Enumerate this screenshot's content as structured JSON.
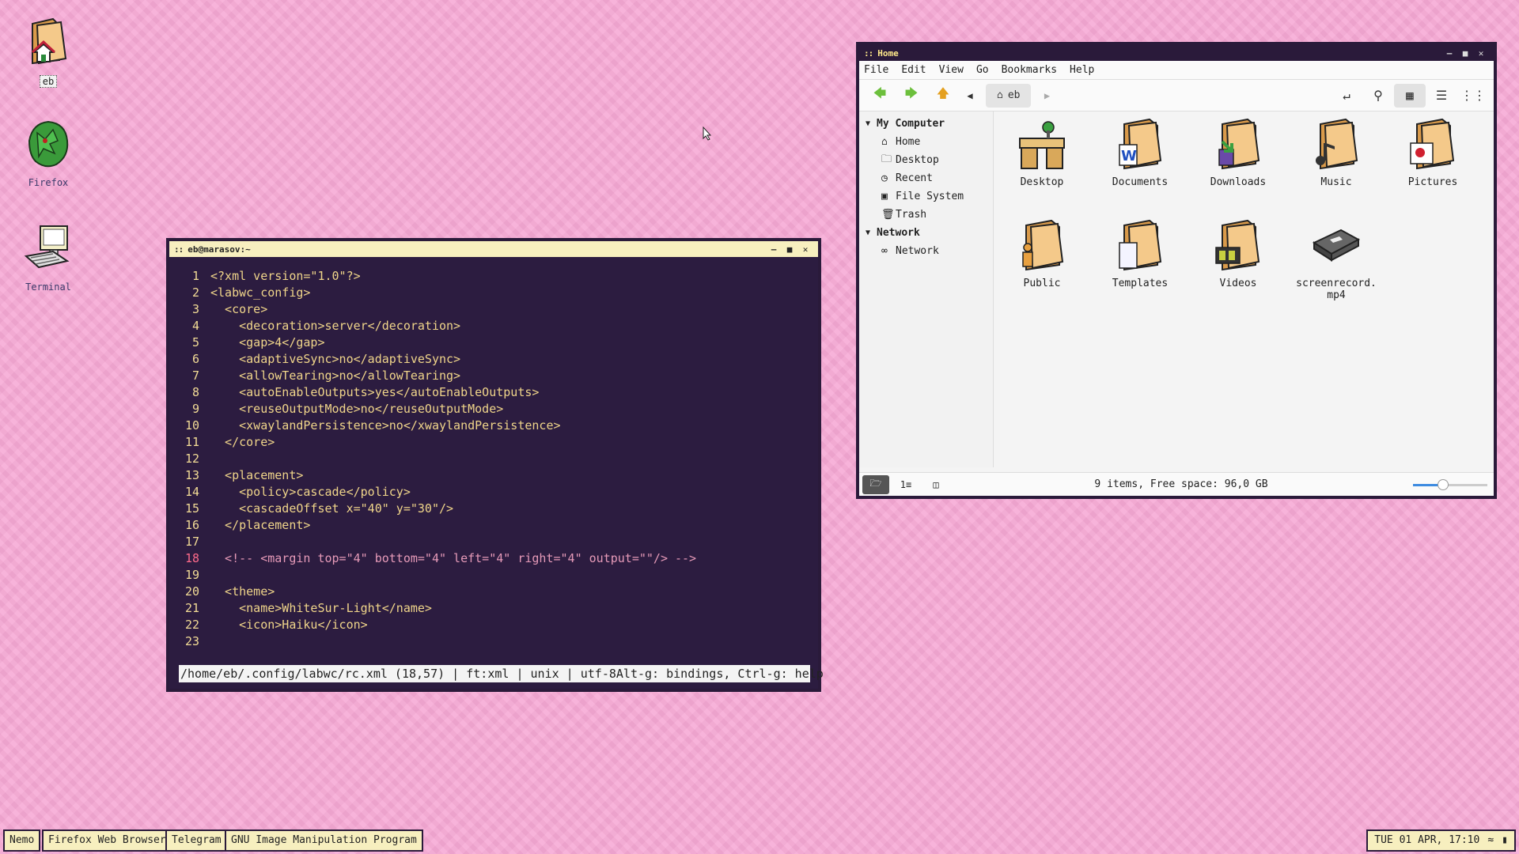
{
  "desktop": {
    "icons": [
      {
        "label": "eb"
      },
      {
        "label": "Firefox"
      },
      {
        "label": "Terminal"
      }
    ]
  },
  "terminal": {
    "title": "eb@marasov:~",
    "lines": [
      {
        "n": "1",
        "text": "<?xml version=\"1.0\"?>"
      },
      {
        "n": "2",
        "text": "<labwc_config>"
      },
      {
        "n": "3",
        "text": "  <core>"
      },
      {
        "n": "4",
        "text": "    <decoration>server</decoration>"
      },
      {
        "n": "5",
        "text": "    <gap>4</gap>"
      },
      {
        "n": "6",
        "text": "    <adaptiveSync>no</adaptiveSync>"
      },
      {
        "n": "7",
        "text": "    <allowTearing>no</allowTearing>"
      },
      {
        "n": "8",
        "text": "    <autoEnableOutputs>yes</autoEnableOutputs>"
      },
      {
        "n": "9",
        "text": "    <reuseOutputMode>no</reuseOutputMode>"
      },
      {
        "n": "10",
        "text": "    <xwaylandPersistence>no</xwaylandPersistence>"
      },
      {
        "n": "11",
        "text": "  </core>"
      },
      {
        "n": "12",
        "text": ""
      },
      {
        "n": "13",
        "text": "  <placement>"
      },
      {
        "n": "14",
        "text": "    <policy>cascade</policy>"
      },
      {
        "n": "15",
        "text": "    <cascadeOffset x=\"40\" y=\"30\"/>"
      },
      {
        "n": "16",
        "text": "  </placement>"
      },
      {
        "n": "17",
        "text": ""
      },
      {
        "n": "18",
        "text": "  <!-- <margin top=\"4\" bottom=\"4\" left=\"4\" right=\"4\" output=\"\"/> -->"
      },
      {
        "n": "19",
        "text": ""
      },
      {
        "n": "20",
        "text": "  <theme>"
      },
      {
        "n": "21",
        "text": "    <name>WhiteSur-Light</name>"
      },
      {
        "n": "22",
        "text": "    <icon>Haiku</icon>"
      },
      {
        "n": "23",
        "text": ""
      }
    ],
    "status_left": "/home/eb/.config/labwc/rc.xml (18,57) | ft:xml | unix | utf-8",
    "status_right": "Alt-g: bindings, Ctrl-g: help"
  },
  "filemanager": {
    "title": "Home",
    "menu": [
      "File",
      "Edit",
      "View",
      "Go",
      "Bookmarks",
      "Help"
    ],
    "breadcrumb": "eb",
    "sidebar": {
      "sections": [
        {
          "label": "My Computer",
          "items": [
            {
              "label": "Home",
              "icon": "home-icon"
            },
            {
              "label": "Desktop",
              "icon": "folder-icon"
            },
            {
              "label": "Recent",
              "icon": "clock-icon"
            },
            {
              "label": "File System",
              "icon": "drive-icon"
            },
            {
              "label": "Trash",
              "icon": "trash-icon"
            }
          ]
        },
        {
          "label": "Network",
          "items": [
            {
              "label": "Network",
              "icon": "network-icon"
            }
          ]
        }
      ]
    },
    "files": [
      {
        "label": "Desktop"
      },
      {
        "label": "Documents"
      },
      {
        "label": "Downloads"
      },
      {
        "label": "Music"
      },
      {
        "label": "Pictures"
      },
      {
        "label": "Public"
      },
      {
        "label": "Templates"
      },
      {
        "label": "Videos"
      },
      {
        "label": "screenrecord.\nmp4"
      }
    ],
    "status": "9 items, Free space: 96,0 GB",
    "zoom_fraction": 0.4
  },
  "taskbar": {
    "tasks": [
      "Nemo",
      "Firefox Web Browser",
      "Telegram",
      "GNU Image Manipulation Program"
    ],
    "clock": "TUE 01 APR, 17:10"
  },
  "colors": {
    "desktop": "#f6a8d4",
    "terminal_bg": "#2c1c40",
    "terminal_text": "#f0d58a",
    "titlebar": "#f7efbf"
  }
}
